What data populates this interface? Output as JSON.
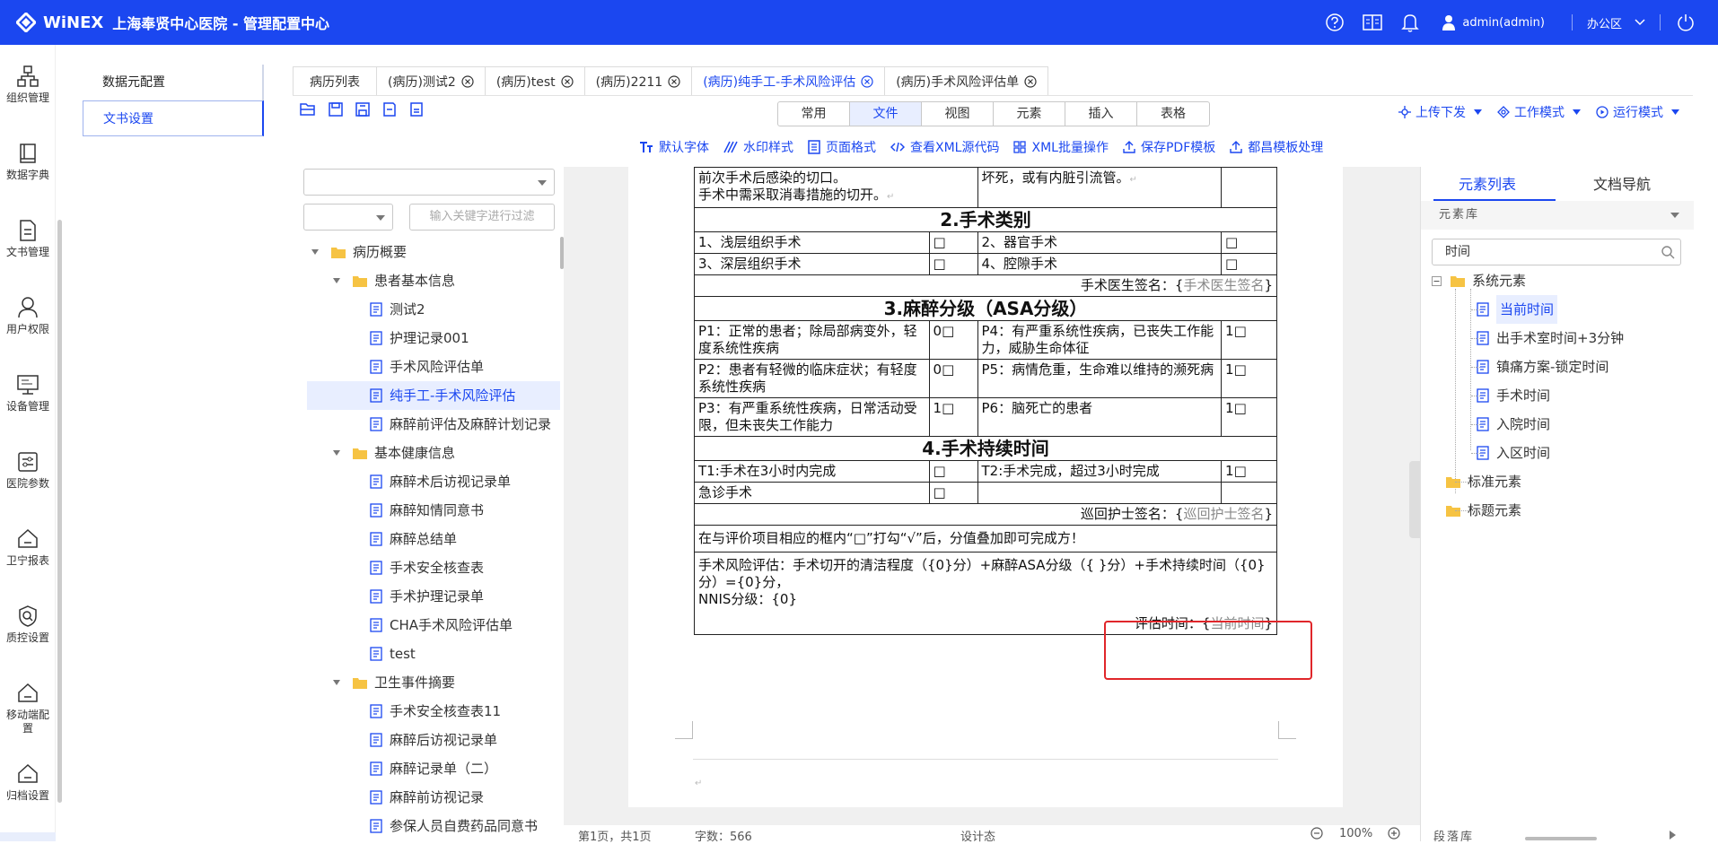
{
  "header": {
    "brand": "WiNEX",
    "title": "上海奉贤中心医院 - 管理配置中心",
    "user": "admin(admin)",
    "office": "办公区"
  },
  "rail": [
    {
      "label": "组织管理",
      "icon": "org-icon"
    },
    {
      "label": "数据字典",
      "icon": "book-icon"
    },
    {
      "label": "文书管理",
      "icon": "document-icon"
    },
    {
      "label": "用户权限",
      "icon": "user-icon"
    },
    {
      "label": "设备管理",
      "icon": "monitor-icon"
    },
    {
      "label": "医院参数",
      "icon": "settings-panel-icon"
    },
    {
      "label": "卫宁报表",
      "icon": "home-icon"
    },
    {
      "label": "质控设置",
      "icon": "shield-search-icon"
    },
    {
      "label": "移动端配置",
      "icon": "home-icon"
    },
    {
      "label": "归档设置",
      "icon": "home-icon"
    }
  ],
  "config_menu": [
    "数据元配置",
    "文书设置"
  ],
  "tabs": [
    {
      "label": "病历列表"
    },
    {
      "label": "(病历)测试2"
    },
    {
      "label": "(病历)test"
    },
    {
      "label": "(病历)2211"
    },
    {
      "label": "(病历)纯手工-手术风险评估"
    },
    {
      "label": "(病历)手术风险评估单"
    }
  ],
  "mode_tabs": [
    "常用",
    "文件",
    "视图",
    "元素",
    "插入",
    "表格"
  ],
  "right_modes": [
    "上传下发",
    "工作模式",
    "运行模式"
  ],
  "sub_tools": [
    "默认字体",
    "水印样式",
    "页面格式",
    "查看XML源代码",
    "XML批量操作",
    "保存PDF模板",
    "都昌模板处理"
  ],
  "tree": {
    "filter_placeholder": "输入关键字进行过滤",
    "nodes": [
      "病历概要",
      "患者基本信息",
      "测试2",
      "护理记录001",
      "手术风险评估单",
      "纯手工-手术风险评估",
      "麻醉前评估及麻醉计划记录",
      "基本健康信息",
      "麻醉术后访视记录单",
      "麻醉知情同意书",
      "麻醉总结单",
      "手术安全核查表",
      "手术护理记录单",
      "CHA手术风险评估单",
      "test",
      "卫生事件摘要",
      "手术安全核查表11",
      "麻醉后访视记录单",
      "麻醉记录单（二）",
      "麻醉前访视记录",
      "参保人员自费药品同意书"
    ]
  },
  "doc": {
    "top_left_1": "前次手术后感染的切口。",
    "top_left_2": "手术中需采取消毒措施的切开。",
    "top_right": "坏死，或有内脏引流管。",
    "sec2": "2.手术类别",
    "s2_r1_a": "1、浅层组织手术",
    "s2_r1_b": "2、器官手术",
    "s2_r2_a": "3、深层组织手术",
    "s2_r2_b": "4、腔隙手术",
    "sign1_label": "手术医生签名：{",
    "sign1_value": "手术医生签名",
    "sec3": "3.麻醉分级（ASA分级）",
    "p1": "P1：正常的患者；除局部病变外，轻度系统性疾病",
    "p1_score": "0□",
    "p4": "P4：有严重系统性疾病，已丧失工作能力，威胁生命体征",
    "p4_score": "1□",
    "p2": "P2：患者有轻微的临床症状；有轻度系统性疾病",
    "p2_score": "0□",
    "p5": "P5：病情危重，生命难以维持的濒死病",
    "p5_score": "1□",
    "p3": "P3：有严重系统性疾病，日常活动受限，但未丧失工作能力",
    "p3_score": "1□",
    "p6": "P6：脑死亡的患者",
    "p6_score": "1□",
    "sec4": "4.手术持续时间",
    "t1": "T1:手术在3小时内完成",
    "t2": "T2:手术完成，超过3小时完成",
    "t2_score": "1□",
    "emergency": "急诊手术",
    "sign2_label": "巡回护士签名：{",
    "sign2_value": "巡回护士签名",
    "instruction": "在与评价项目相应的框内“□”打勾“√”后，分值叠加即可完成方！",
    "formula": "手术风险评估：手术切开的清洁程度（{0}分）+麻醉ASA分级（{ }分）+手术持续时间（{0}分）={0}分，",
    "nnis": "NNIS分级：{0}",
    "eval_label": "评估时间：{",
    "eval_value": "当前时间",
    "box": "□",
    "brace_close": "}"
  },
  "status": {
    "page": "第1页，共1页",
    "words": "字数：566",
    "state": "设计态",
    "zoom": "100%"
  },
  "rpanel": {
    "tab1": "元素列表",
    "tab2": "文档导航",
    "lib": "元素库",
    "search": "时间",
    "nodes": [
      "系统元素",
      "当前时间",
      "出手术室时间+3分钟",
      "镇痛方案-锁定时间",
      "手术时间",
      "入院时间",
      "入区时间",
      "标准元素",
      "标题元素"
    ],
    "bottom": "段落库"
  },
  "colors": {
    "brand": "#1b47f0",
    "highlight": "#e0262a",
    "folder": "#f6c343"
  }
}
